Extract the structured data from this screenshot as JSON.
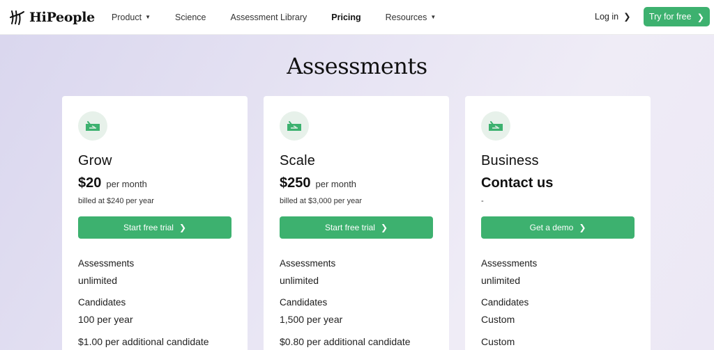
{
  "brand": {
    "name": "HiPeople"
  },
  "nav": {
    "items": [
      {
        "label": "Product",
        "has_dropdown": true
      },
      {
        "label": "Science",
        "has_dropdown": false
      },
      {
        "label": "Assessment Library",
        "has_dropdown": false
      },
      {
        "label": "Pricing",
        "has_dropdown": false,
        "active": true
      },
      {
        "label": "Resources",
        "has_dropdown": true
      }
    ],
    "login_label": "Log in",
    "try_label": "Try for free"
  },
  "page": {
    "title": "Assessments"
  },
  "plans": [
    {
      "name": "Grow",
      "price": "$20",
      "period": "per month",
      "billed": "billed at $240 per year",
      "cta": "Start free trial",
      "assessments_label": "Assessments",
      "assessments_value": "unlimited",
      "candidates_label": "Candidates",
      "candidates_value": "100 per year",
      "extra": "$1.00 per additional candidate"
    },
    {
      "name": "Scale",
      "price": "$250",
      "period": "per month",
      "billed": "billed at $3,000 per year",
      "cta": "Start free trial",
      "assessments_label": "Assessments",
      "assessments_value": "unlimited",
      "candidates_label": "Candidates",
      "candidates_value": "1,500 per year",
      "extra": "$0.80 per additional candidate"
    },
    {
      "name": "Business",
      "price": "Contact us",
      "period": "",
      "billed": "-",
      "cta": "Get a demo",
      "assessments_label": "Assessments",
      "assessments_value": "unlimited",
      "candidates_label": "Candidates",
      "candidates_value": "Custom",
      "extra": "Custom"
    }
  ],
  "icons": {
    "logo": "hipeople-logo-icon",
    "plan": "cheque-icon",
    "dropdown": "chevron-down-icon",
    "arrow": "chevron-right-icon"
  },
  "colors": {
    "accent": "#3db16f",
    "icon_bg": "#e7f1ea"
  }
}
